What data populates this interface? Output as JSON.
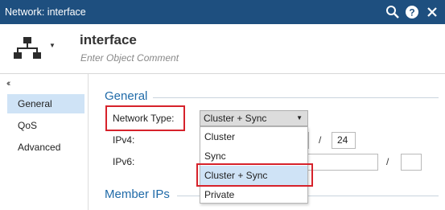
{
  "window": {
    "title": "Network: interface",
    "controls": [
      "search-icon",
      "help-icon",
      "close-icon"
    ]
  },
  "object": {
    "name": "interface",
    "comment_placeholder": "Enter Object Comment",
    "icon": "network-topology-icon"
  },
  "sidebar": {
    "collapse_glyph": "‹‹",
    "items": [
      {
        "label": "General",
        "active": true
      },
      {
        "label": "QoS",
        "active": false
      },
      {
        "label": "Advanced",
        "active": false
      }
    ]
  },
  "general": {
    "section_title": "General",
    "network_type_label": "Network Type:",
    "network_type_value": "Cluster + Sync",
    "ipv4_label": "IPv4:",
    "ipv4_mask": "24",
    "ipv6_label": "IPv6:",
    "ipv6_prefix": "",
    "slash": "/",
    "dropdown_options": [
      {
        "label": "Cluster",
        "selected": false
      },
      {
        "label": "Sync",
        "selected": false
      },
      {
        "label": "Cluster + Sync",
        "selected": true
      },
      {
        "label": "Private",
        "selected": false
      }
    ]
  },
  "member_ips": {
    "section_title": "Member IPs"
  },
  "colors": {
    "titlebar": "#1e4f7f",
    "accent": "#1f6aa8",
    "highlight": "#cfe3f6",
    "callout": "#d6222b"
  }
}
